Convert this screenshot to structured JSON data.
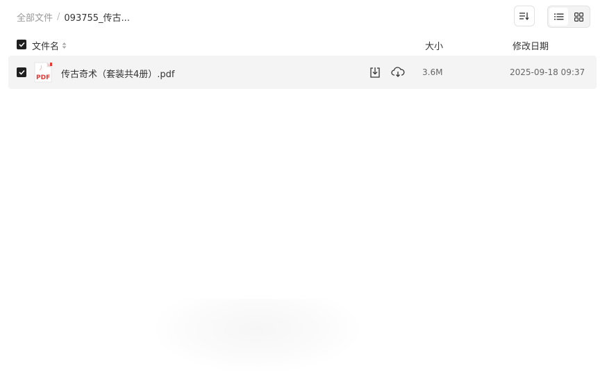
{
  "breadcrumb": {
    "root": "全部文件",
    "separator": "/",
    "current": "093755_传古..."
  },
  "toolbar": {
    "sort_icon": "sort-icon",
    "view_modes": [
      "list-view-icon",
      "grid-view-icon"
    ],
    "active_view": "list"
  },
  "header": {
    "name": "文件名",
    "size": "大小",
    "modified": "修改日期"
  },
  "files": [
    {
      "icon": "pdf-file-icon",
      "icon_label": "PDF",
      "name": "传古奇术（套装共4册）.pdf",
      "size": "3.6M",
      "modified": "2025-09-18 09:37",
      "checked": true
    }
  ],
  "colors": {
    "row_bg": "#f4f4f5",
    "checkbox": "#1f1f1f",
    "pdf_red": "#e53935"
  }
}
